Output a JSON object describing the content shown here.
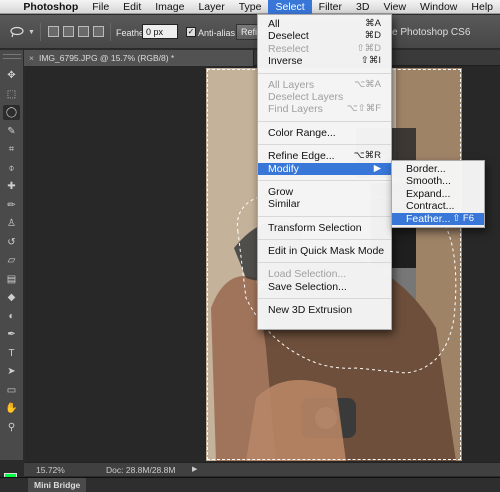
{
  "menubar": {
    "items": [
      "Photoshop",
      "File",
      "Edit",
      "Image",
      "Layer",
      "Type",
      "Select",
      "Filter",
      "3D",
      "View",
      "Window",
      "Help"
    ],
    "active": "Select"
  },
  "options": {
    "feather_label": "Feather:",
    "feather_value": "0 px",
    "antialias_label": "Anti-alias",
    "antialias_checked": true,
    "refine_label": "Refine Edge...",
    "window_title": "e Photoshop CS6"
  },
  "document": {
    "tab_title": "IMG_6795.JPG @ 15.7% (RGB/8) *",
    "close_glyph": "×"
  },
  "tools": [
    "move-icon",
    "marquee-icon",
    "lasso-icon",
    "quick-select-icon",
    "crop-icon",
    "eyedropper-icon",
    "spot-heal-icon",
    "brush-icon",
    "clone-stamp-icon",
    "history-brush-icon",
    "eraser-icon",
    "gradient-icon",
    "blur-icon",
    "dodge-icon",
    "pen-icon",
    "type-icon",
    "path-select-icon",
    "shape-icon",
    "hand-icon",
    "zoom-icon"
  ],
  "colors": {
    "foreground": "#00ff44",
    "background": "#111111",
    "highlight": "#3876d8"
  },
  "status": {
    "zoom": "15.72%",
    "doc_size": "Doc: 28.8M/28.8M"
  },
  "panel_tab": "Mini Bridge",
  "select_menu": {
    "groups": [
      [
        {
          "label": "All",
          "shortcut": "⌘A",
          "disabled": false
        },
        {
          "label": "Deselect",
          "shortcut": "⌘D",
          "disabled": false
        },
        {
          "label": "Reselect",
          "shortcut": "⇧⌘D",
          "disabled": true
        },
        {
          "label": "Inverse",
          "shortcut": "⇧⌘I",
          "disabled": false
        }
      ],
      [
        {
          "label": "All Layers",
          "shortcut": "⌥⌘A",
          "disabled": true
        },
        {
          "label": "Deselect Layers",
          "shortcut": "",
          "disabled": true
        },
        {
          "label": "Find Layers",
          "shortcut": "⌥⇧⌘F",
          "disabled": true
        }
      ],
      [
        {
          "label": "Color Range...",
          "shortcut": "",
          "disabled": false
        }
      ],
      [
        {
          "label": "Refine Edge...",
          "shortcut": "⌥⌘R",
          "disabled": false
        },
        {
          "label": "Modify",
          "shortcut": "▶",
          "disabled": false,
          "highlighted": true
        }
      ],
      [
        {
          "label": "Grow",
          "shortcut": "",
          "disabled": false
        },
        {
          "label": "Similar",
          "shortcut": "",
          "disabled": false
        }
      ],
      [
        {
          "label": "Transform Selection",
          "shortcut": "",
          "disabled": false
        }
      ],
      [
        {
          "label": "Edit in Quick Mask Mode",
          "shortcut": "",
          "disabled": false
        }
      ],
      [
        {
          "label": "Load Selection...",
          "shortcut": "",
          "disabled": true
        },
        {
          "label": "Save Selection...",
          "shortcut": "",
          "disabled": false
        }
      ],
      [
        {
          "label": "New 3D Extrusion",
          "shortcut": "",
          "disabled": false
        }
      ]
    ]
  },
  "modify_menu": {
    "items": [
      {
        "label": "Border...",
        "shortcut": ""
      },
      {
        "label": "Smooth...",
        "shortcut": ""
      },
      {
        "label": "Expand...",
        "shortcut": ""
      },
      {
        "label": "Contract...",
        "shortcut": ""
      },
      {
        "label": "Feather...",
        "shortcut": "⇧ F6",
        "highlighted": true
      }
    ]
  }
}
